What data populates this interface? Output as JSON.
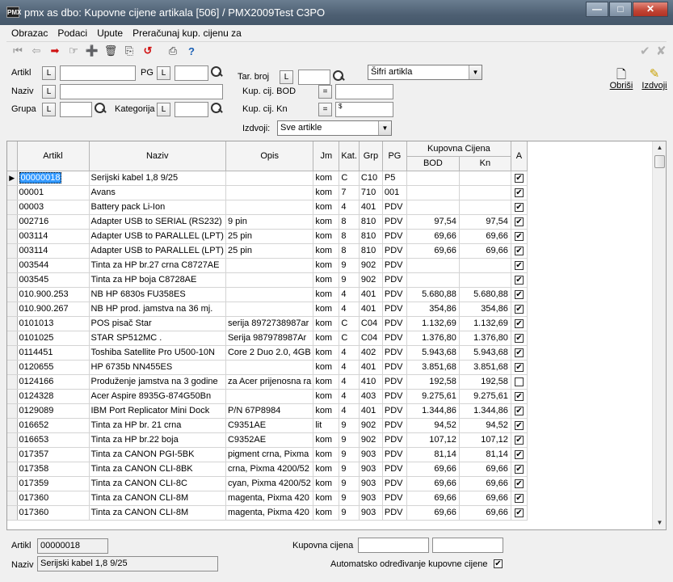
{
  "window": {
    "app_icon": "PMX",
    "title": "pmx as dbo: Kupovne cijene artikala [506] / PMX2009Test C3PO",
    "buttons": {
      "minimize": "—",
      "maximize": "□",
      "close": "✕"
    }
  },
  "menu": [
    "Obrazac",
    "Podaci",
    "Upute",
    "Preračunaj kup. cijenu za"
  ],
  "toolbar": {
    "icons": [
      "first-record-icon",
      "previous-record-icon",
      "next-record-icon",
      "last-record-icon",
      "new-record-icon",
      "delete-icon",
      "copy-icon",
      "undo-icon",
      "print-icon",
      "help-icon",
      "confirm-icon",
      "cancel-icon"
    ],
    "glyphs": {
      "first": "⏮",
      "prev": "⇦",
      "next": "➡",
      "last": "☞",
      "new": "➕",
      "delete": "🗑",
      "copy": "⎘",
      "undo": "↺",
      "print": "⎙",
      "help": "?",
      "confirm": "✔",
      "cancel": "✘"
    }
  },
  "filters": {
    "artikl_label": "Artikl",
    "pg_label": "PG",
    "naziv_label": "Naziv",
    "grupa_label": "Grupa",
    "kategorija_label": "Kategorija",
    "tar_broj_label": "Tar. broj",
    "kup_cij_bod_label": "Kup. cij. BOD",
    "kup_cij_kn_label": "Kup. cij. Kn",
    "izdvoji_label": "Izdvoji:",
    "l_button": "L",
    "eq_button": "=",
    "kn_prefix": "$",
    "sifri_select": "Šifri artikla",
    "izdvoji_select": "Sve artikle",
    "obrisi_label": "Obriši",
    "izdvoji_button_label": "Izdvoji"
  },
  "grid": {
    "columns": [
      "Artikl",
      "Naziv",
      "Opis",
      "Jm",
      "Kat.",
      "Grp",
      "PG",
      "Kupovna Cijena",
      "BOD",
      "Kn",
      "A"
    ],
    "rows": [
      {
        "artikl": "00000018",
        "naziv": "Serijski kabel 1,8 9/25",
        "opis": "",
        "jm": "kom",
        "kat": "C",
        "grp": "C10",
        "pg": "P5",
        "bod": "",
        "kn": "",
        "a": true
      },
      {
        "artikl": "00001",
        "naziv": "Avans",
        "opis": "",
        "jm": "kom",
        "kat": "7",
        "grp": "710",
        "pg": "001",
        "bod": "",
        "kn": "",
        "a": true
      },
      {
        "artikl": "00003",
        "naziv": "Battery pack Li-Ion",
        "opis": "",
        "jm": "kom",
        "kat": "4",
        "grp": "401",
        "pg": "PDV",
        "bod": "",
        "kn": "",
        "a": true
      },
      {
        "artikl": "002716",
        "naziv": "Adapter USB to SERIAL (RS232)",
        "opis": "9 pin",
        "jm": "kom",
        "kat": "8",
        "grp": "810",
        "pg": "PDV",
        "bod": "97,54",
        "kn": "97,54",
        "a": true
      },
      {
        "artikl": "003114",
        "naziv": "Adapter USB to PARALLEL (LPT)",
        "opis": "25 pin",
        "jm": "kom",
        "kat": "8",
        "grp": "810",
        "pg": "PDV",
        "bod": "69,66",
        "kn": "69,66",
        "a": true
      },
      {
        "artikl": "003114",
        "naziv": "Adapter USB to PARALLEL (LPT)",
        "opis": "25 pin",
        "jm": "kom",
        "kat": "8",
        "grp": "810",
        "pg": "PDV",
        "bod": "69,66",
        "kn": "69,66",
        "a": true
      },
      {
        "artikl": "003544",
        "naziv": "Tinta za HP br.27 crna C8727AE",
        "opis": "",
        "jm": "kom",
        "kat": "9",
        "grp": "902",
        "pg": "PDV",
        "bod": "",
        "kn": "",
        "a": true
      },
      {
        "artikl": "003545",
        "naziv": "Tinta za HP boja C8728AE",
        "opis": "",
        "jm": "kom",
        "kat": "9",
        "grp": "902",
        "pg": "PDV",
        "bod": "",
        "kn": "",
        "a": true
      },
      {
        "artikl": "010.900.253",
        "naziv": "NB HP 6830s FU358ES",
        "opis": "",
        "jm": "kom",
        "kat": "4",
        "grp": "401",
        "pg": "PDV",
        "bod": "5.680,88",
        "kn": "5.680,88",
        "a": true
      },
      {
        "artikl": "010.900.267",
        "naziv": "NB HP prod. jamstva na 36 mj.",
        "opis": "",
        "jm": "kom",
        "kat": "4",
        "grp": "401",
        "pg": "PDV",
        "bod": "354,86",
        "kn": "354,86",
        "a": true
      },
      {
        "artikl": "0101013",
        "naziv": "POS pisač Star",
        "opis": "serija 8972738987ar",
        "jm": "kom",
        "kat": "C",
        "grp": "C04",
        "pg": "PDV",
        "bod": "1.132,69",
        "kn": "1.132,69",
        "a": true
      },
      {
        "artikl": "0101025",
        "naziv": "STAR SP512MC .",
        "opis": "Serija 987978987Ar",
        "jm": "kom",
        "kat": "C",
        "grp": "C04",
        "pg": "PDV",
        "bod": "1.376,80",
        "kn": "1.376,80",
        "a": true
      },
      {
        "artikl": "0114451",
        "naziv": "Toshiba Satellite Pro U500-10N",
        "opis": "Core 2 Duo 2.0, 4GB",
        "jm": "kom",
        "kat": "4",
        "grp": "402",
        "pg": "PDV",
        "bod": "5.943,68",
        "kn": "5.943,68",
        "a": true
      },
      {
        "artikl": "0120655",
        "naziv": "HP 6735b NN455ES",
        "opis": "",
        "jm": "kom",
        "kat": "4",
        "grp": "401",
        "pg": "PDV",
        "bod": "3.851,68",
        "kn": "3.851,68",
        "a": true
      },
      {
        "artikl": "0124166",
        "naziv": "Produženje jamstva na 3 godine",
        "opis": "za Acer prijenosna ra",
        "jm": "kom",
        "kat": "4",
        "grp": "410",
        "pg": "PDV",
        "bod": "192,58",
        "kn": "192,58",
        "a": false
      },
      {
        "artikl": "0124328",
        "naziv": "Acer Aspire 8935G-874G50Bn",
        "opis": "",
        "jm": "kom",
        "kat": "4",
        "grp": "403",
        "pg": "PDV",
        "bod": "9.275,61",
        "kn": "9.275,61",
        "a": true
      },
      {
        "artikl": "0129089",
        "naziv": "IBM Port Replicator Mini Dock",
        "opis": "P/N 67P8984",
        "jm": "kom",
        "kat": "4",
        "grp": "401",
        "pg": "PDV",
        "bod": "1.344,86",
        "kn": "1.344,86",
        "a": true
      },
      {
        "artikl": "016652",
        "naziv": "Tinta za HP br. 21 crna",
        "opis": "C9351AE",
        "jm": "lit",
        "kat": "9",
        "grp": "902",
        "pg": "PDV",
        "bod": "94,52",
        "kn": "94,52",
        "a": true
      },
      {
        "artikl": "016653",
        "naziv": "Tinta za HP br.22 boja",
        "opis": "C9352AE",
        "jm": "kom",
        "kat": "9",
        "grp": "902",
        "pg": "PDV",
        "bod": "107,12",
        "kn": "107,12",
        "a": true
      },
      {
        "artikl": "017357",
        "naziv": "Tinta za CANON PGI-5BK",
        "opis": "pigment crna, Pixma",
        "jm": "kom",
        "kat": "9",
        "grp": "903",
        "pg": "PDV",
        "bod": "81,14",
        "kn": "81,14",
        "a": true
      },
      {
        "artikl": "017358",
        "naziv": "Tinta za CANON CLI-8BK",
        "opis": "crna, Pixma 4200/52",
        "jm": "kom",
        "kat": "9",
        "grp": "903",
        "pg": "PDV",
        "bod": "69,66",
        "kn": "69,66",
        "a": true
      },
      {
        "artikl": "017359",
        "naziv": "Tinta za CANON CLI-8C",
        "opis": "cyan, Pixma 4200/52",
        "jm": "kom",
        "kat": "9",
        "grp": "903",
        "pg": "PDV",
        "bod": "69,66",
        "kn": "69,66",
        "a": true
      },
      {
        "artikl": "017360",
        "naziv": "Tinta za CANON CLI-8M",
        "opis": "magenta, Pixma 420",
        "jm": "kom",
        "kat": "9",
        "grp": "903",
        "pg": "PDV",
        "bod": "69,66",
        "kn": "69,66",
        "a": true
      },
      {
        "artikl": "017360",
        "naziv": "Tinta za CANON CLI-8M",
        "opis": "magenta, Pixma 420",
        "jm": "kom",
        "kat": "9",
        "grp": "903",
        "pg": "PDV",
        "bod": "69,66",
        "kn": "69,66",
        "a": true
      }
    ]
  },
  "detail": {
    "artikl_label": "Artikl",
    "artikl_value": "00000018",
    "naziv_label": "Naziv",
    "naziv_value": "Serijski kabel 1,8 9/25",
    "kupovna_cijena_label": "Kupovna cijena",
    "auto_label": "Automatsko određivanje kupovne cijene",
    "auto_checked": true
  },
  "colors": {
    "selection": "#3399ff",
    "titlebar": "#4d5f72",
    "close": "#c14434"
  }
}
